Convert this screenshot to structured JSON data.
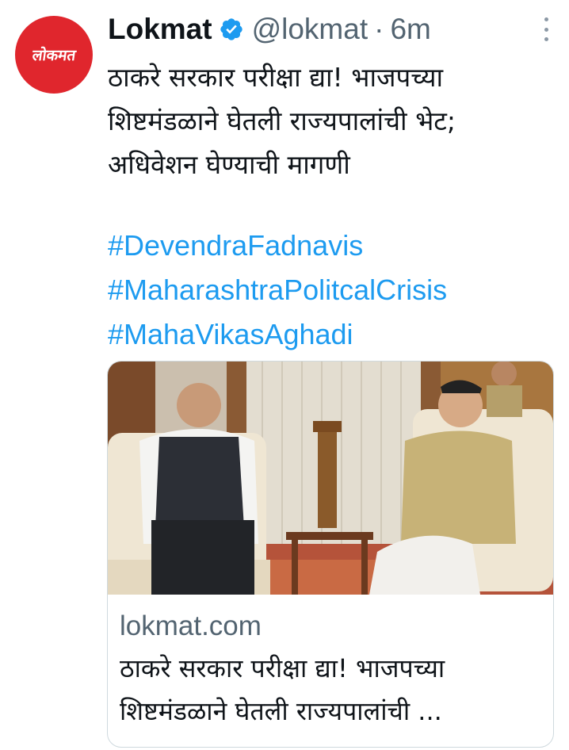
{
  "author": {
    "name": "Lokmat",
    "handle": "@lokmat",
    "separator": "·",
    "time": "6m",
    "avatar_text": "लोकमत",
    "avatar_color": "#e0262d",
    "verified_color": "#1d9bf0"
  },
  "tweet": {
    "text_lines": [
      "ठाकरे सरकार परीक्षा द्या! भाजपच्या",
      "शिष्टमंडळाने घेतली राज्यपालांची भेट;",
      "अधिवेशन घेण्याची मागणी"
    ],
    "hashtags": [
      "#DevendraFadnavis",
      "#MaharashtraPolitcalCrisis",
      "#MahaVikasAghadi"
    ],
    "link_color": "#1d9bf0"
  },
  "card": {
    "domain": "lokmat.com",
    "title_lines": [
      "ठाकरे सरकार परीक्षा द्या! भाजपच्या",
      "शिष्टमंडळाने घेतली राज्यपालांची ..."
    ]
  }
}
